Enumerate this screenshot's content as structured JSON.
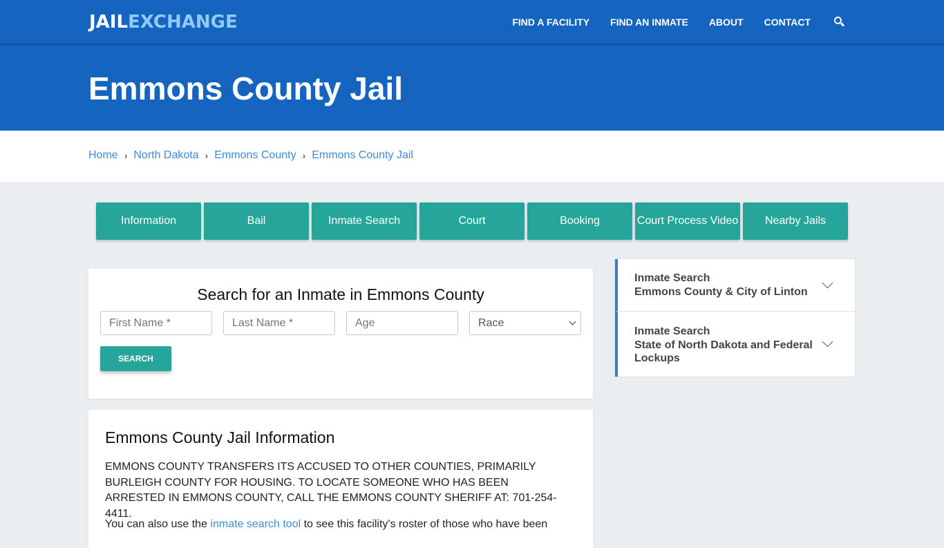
{
  "site": {
    "logo_part1": "JAIL",
    "logo_part2": "EXCHANGE",
    "nav": [
      "FIND A FACILITY",
      "FIND AN INMATE",
      "ABOUT",
      "CONTACT"
    ],
    "search_icon": "search-icon"
  },
  "hero": {
    "title": "Emmons County Jail"
  },
  "breadcrumb": [
    "Home",
    "North Dakota",
    "Emmons County",
    "Emmons County Jail"
  ],
  "tabs": [
    "Information",
    "Bail",
    "Inmate Search",
    "Court",
    "Booking",
    "Court Process Video",
    "Nearby Jails"
  ],
  "search_form": {
    "title": "Search for an Inmate in Emmons County",
    "first_name_placeholder": "First Name *",
    "last_name_placeholder": "Last Name *",
    "age_placeholder": "Age",
    "race_selected": "Race",
    "button": "SEARCH"
  },
  "info": {
    "title": "Emmons County Jail Information",
    "paragraph1": "EMMONS COUNTY TRANSFERS ITS ACCUSED TO OTHER COUNTIES, PRIMARILY BURLEIGH COUNTY FOR HOUSING.  TO LOCATE SOMEONE WHO HAS BEEN ARRESTED IN EMMONS COUNTY, CALL THE EMMONS COUNTY SHERIFF AT: 701-254-4411.",
    "paragraph2_before": "You can also use the ",
    "paragraph2_link": "inmate search tool",
    "paragraph2_after": " to see this facility's roster of those who have been"
  },
  "sidebar": {
    "items": [
      {
        "line1": "Inmate Search",
        "line2": "Emmons County & City of Linton"
      },
      {
        "line1": "Inmate Search",
        "line2": "State of North Dakota and Federal Lockups"
      }
    ]
  },
  "colors": {
    "brand_blue": "#1565c0",
    "logo_light_blue": "#90caf9",
    "teal": "#26a69a",
    "link_blue": "#3d8bd9",
    "accent_bar": "#2f80d1"
  }
}
